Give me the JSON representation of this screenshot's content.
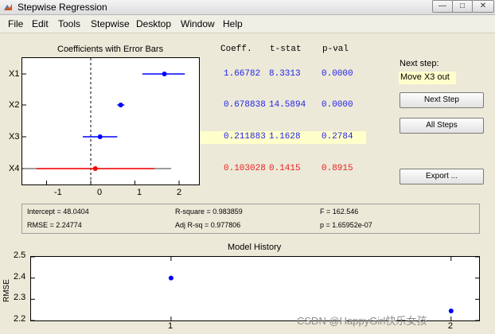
{
  "window": {
    "title": "Stepwise Regression",
    "controls": [
      "—",
      "□",
      "✕"
    ]
  },
  "menu": [
    "File",
    "Edit",
    "Tools",
    "Stepwise",
    "Desktop",
    "Window",
    "Help"
  ],
  "coef_plot": {
    "title": "Coefficients with Error Bars",
    "labels": [
      "X1",
      "X2",
      "X3",
      "X4"
    ],
    "ticks": [
      "-1",
      "0",
      "1",
      "2"
    ],
    "xlim": [
      -1.55,
      2.45
    ]
  },
  "table": {
    "headers": [
      "Coeff.",
      "t-stat",
      "p-val"
    ],
    "rows": [
      {
        "coeff": "1.66782",
        "tstat": "8.3313",
        "pval": "0.0000",
        "color": "#1f1fe8",
        "highlight": false
      },
      {
        "coeff": "0.678838",
        "tstat": "14.5894",
        "pval": "0.0000",
        "color": "#1f1fe8",
        "highlight": false
      },
      {
        "coeff": "0.211883",
        "tstat": "1.1628",
        "pval": "0.2784",
        "color": "#1f1fe8",
        "highlight": true
      },
      {
        "coeff": "0.103028",
        "tstat": "0.1415",
        "pval": "0.8915",
        "color": "#e82020",
        "highlight": false
      }
    ]
  },
  "errorbars": [
    {
      "est": 1.66782,
      "lo": 1.17,
      "hi": 2.13,
      "color": "#0000ff"
    },
    {
      "est": 0.678838,
      "lo": 0.6,
      "hi": 0.76,
      "color": "#0000ff"
    },
    {
      "est": 0.211883,
      "lo": -0.18,
      "hi": 0.6,
      "color": "#0000ff"
    },
    {
      "est": 0.103028,
      "lo": -1.23,
      "hi": 1.44,
      "color": "#ff0000",
      "outer_lo": -1.52,
      "outer_hi": 1.82
    }
  ],
  "sidebar": {
    "next_step_label": "Next step:",
    "next_step_value": "Move X3 out",
    "buttons": {
      "next": "Next Step",
      "all": "All Steps",
      "export": "Export ..."
    }
  },
  "stats": {
    "intercept": "Intercept = 48.0404",
    "rmse": "RMSE = 2.24774",
    "rsq": "R-square = 0.983859",
    "adjrsq": "Adj R-sq = 0.977806",
    "f": "F = 162.546",
    "p": "p = 1.65952e-07"
  },
  "colors": {
    "blue": "#0000ff",
    "red": "#ff0000",
    "highlight": "#ffffcc"
  },
  "chart_data": {
    "type": "scatter",
    "title": "Model History",
    "xlabel": "",
    "ylabel": "RMSE",
    "xlim": [
      0.5,
      2.1
    ],
    "ylim": [
      2.2,
      2.5
    ],
    "x": [
      1,
      2
    ],
    "y": [
      2.4,
      2.245
    ],
    "x_ticks": [
      "1",
      "2"
    ],
    "y_ticks": [
      "2.2",
      "2.3",
      "2.4",
      "2.5"
    ]
  },
  "watermark": "CSDN @HappyGirl快乐女孩"
}
